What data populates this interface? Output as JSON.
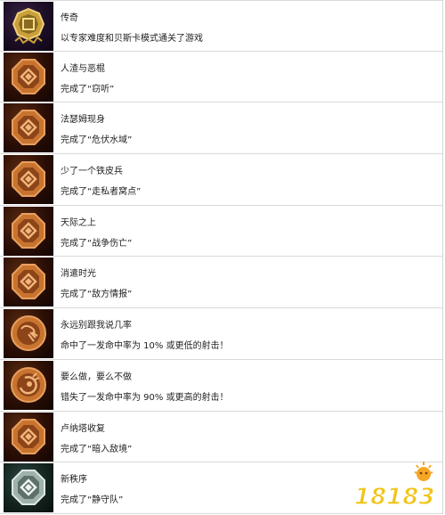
{
  "achievements": [
    {
      "title": "传奇",
      "desc": "以专家难度和贝斯卡模式通关了游戏",
      "badge_icon": "gold-emblem-icon"
    },
    {
      "title": "人渣与恶棍",
      "desc": "完成了“窃听”",
      "badge_icon": "bronze-octagon-icon"
    },
    {
      "title": "法瑟姆现身",
      "desc": "完成了“危伏水域”",
      "badge_icon": "bronze-octagon-icon"
    },
    {
      "title": "少了一个铁皮兵",
      "desc": "完成了“走私者窝点”",
      "badge_icon": "bronze-octagon-icon"
    },
    {
      "title": "天际之上",
      "desc": "完成了“战争伤亡”",
      "badge_icon": "bronze-octagon-icon"
    },
    {
      "title": "消遣时光",
      "desc": "完成了“敌方情报”",
      "badge_icon": "bronze-octagon-icon"
    },
    {
      "title": "永远别跟我说几率",
      "desc": "命中了一发命中率为 10% 或更低的射击！",
      "badge_icon": "bronze-round-hit-icon"
    },
    {
      "title": "要么做，要么不做",
      "desc": "错失了一发命中率为 90% 或更高的射击！",
      "badge_icon": "bronze-round-miss-icon"
    },
    {
      "title": "卢纳塔收复",
      "desc": "完成了“暗入敌境”",
      "badge_icon": "bronze-octagon-icon"
    },
    {
      "title": "新秩序",
      "desc": "完成了“静守队”",
      "badge_icon": "silver-octagon-icon"
    }
  ],
  "watermark": {
    "text": "18183",
    "icon": "sun-mascot-icon"
  },
  "colors": {
    "bronze": "#c8742f",
    "gold": "#d4a93a",
    "silver": "#9fb2ac",
    "text": "#222222"
  }
}
